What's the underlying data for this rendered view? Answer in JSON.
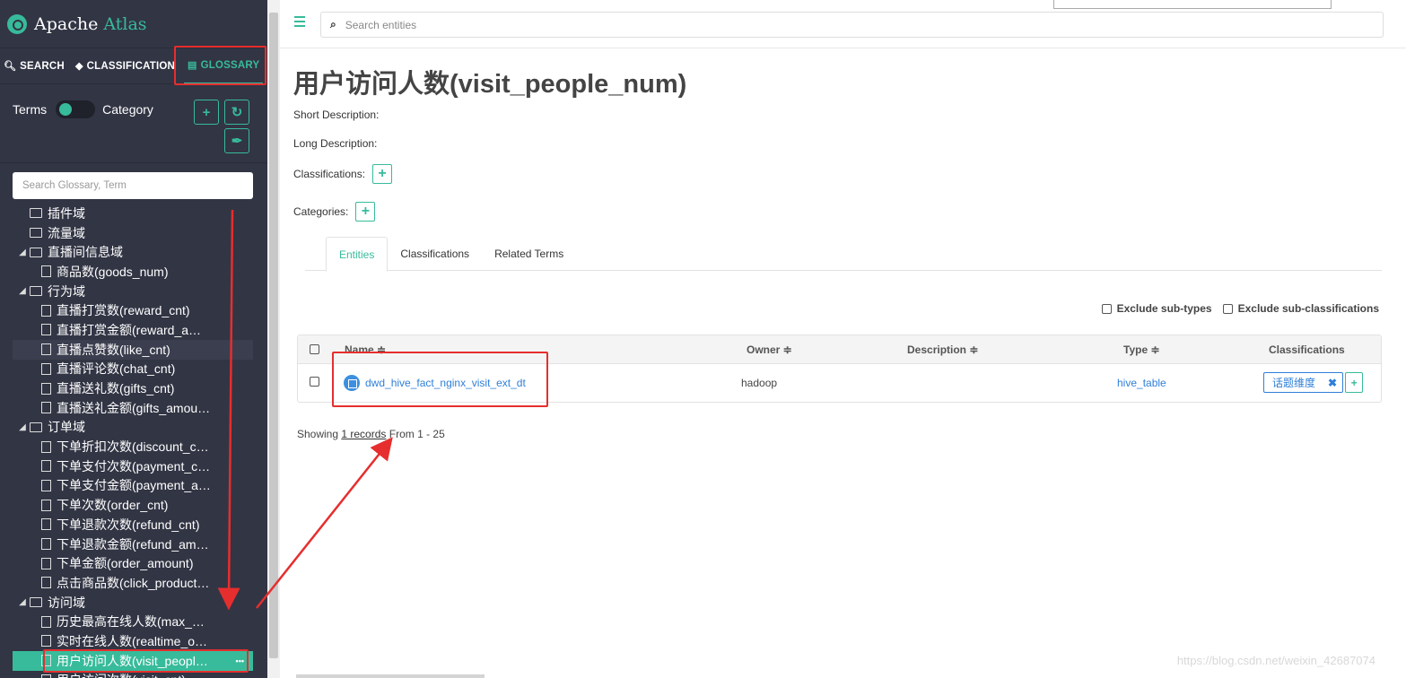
{
  "app": {
    "logo_prefix": "Apache ",
    "logo_accent": "Atlas",
    "accent_color": "#37bb9b",
    "annotation_color": "#e62e2e"
  },
  "sidebar": {
    "nav": {
      "search": "SEARCH",
      "classification": "CLASSIFICATION",
      "glossary": "GLOSSARY"
    },
    "toggle_left": "Terms",
    "toggle_right": "Category",
    "search_placeholder": "Search Glossary, Term",
    "tree": [
      {
        "label": "插件域",
        "type": "folder",
        "level": 0,
        "expanded": false
      },
      {
        "label": "流量域",
        "type": "folder",
        "level": 0,
        "expanded": false
      },
      {
        "label": "直播间信息域",
        "type": "folder",
        "level": 0,
        "expanded": true
      },
      {
        "label": "商品数(goods_num)",
        "type": "term",
        "level": 1
      },
      {
        "label": "行为域",
        "type": "folder",
        "level": 0,
        "expanded": true
      },
      {
        "label": "直播打赏数(reward_cnt)",
        "type": "term",
        "level": 1
      },
      {
        "label": "直播打赏金额(reward_a…",
        "type": "term",
        "level": 1
      },
      {
        "label": "直播点赞数(like_cnt)",
        "type": "term",
        "level": 1,
        "hover": true
      },
      {
        "label": "直播评论数(chat_cnt)",
        "type": "term",
        "level": 1
      },
      {
        "label": "直播送礼数(gifts_cnt)",
        "type": "term",
        "level": 1
      },
      {
        "label": "直播送礼金额(gifts_amou…",
        "type": "term",
        "level": 1
      },
      {
        "label": "订单域",
        "type": "folder",
        "level": 0,
        "expanded": true
      },
      {
        "label": "下单折扣次数(discount_c…",
        "type": "term",
        "level": 1
      },
      {
        "label": "下单支付次数(payment_c…",
        "type": "term",
        "level": 1
      },
      {
        "label": "下单支付金额(payment_a…",
        "type": "term",
        "level": 1
      },
      {
        "label": "下单次数(order_cnt)",
        "type": "term",
        "level": 1
      },
      {
        "label": "下单退款次数(refund_cnt)",
        "type": "term",
        "level": 1
      },
      {
        "label": "下单退款金额(refund_am…",
        "type": "term",
        "level": 1
      },
      {
        "label": "下单金额(order_amount)",
        "type": "term",
        "level": 1
      },
      {
        "label": "点击商品数(click_product…",
        "type": "term",
        "level": 1
      },
      {
        "label": "访问域",
        "type": "folder",
        "level": 0,
        "expanded": true
      },
      {
        "label": "历史最高在线人数(max_…",
        "type": "term",
        "level": 1
      },
      {
        "label": "实时在线人数(realtime_o…",
        "type": "term",
        "level": 1
      },
      {
        "label": "用户访问人数(visit_peopl…",
        "type": "term",
        "level": 1,
        "selected": true
      },
      {
        "label": "用户访问次数(visit_cnt)",
        "type": "term",
        "level": 1
      }
    ]
  },
  "main": {
    "search_placeholder": "Search entities",
    "title": "用户访问人数(visit_people_num)",
    "short_description_label": "Short Description:",
    "long_description_label": "Long Description:",
    "classifications_label": "Classifications:",
    "categories_label": "Categories:",
    "tabs": [
      "Entities",
      "Classifications",
      "Related Terms"
    ],
    "exclude_subtypes": "Exclude sub-types",
    "exclude_subclassifications": "Exclude sub-classifications",
    "table": {
      "columns": [
        "Name ≑",
        "Owner ≑",
        "Description ≑",
        "Type ≑",
        "Classifications"
      ],
      "rows": [
        {
          "name": "dwd_hive_fact_nginx_visit_ext_dt",
          "owner": "hadoop",
          "description": "",
          "type": "hive_table",
          "classification": "话题维度"
        }
      ]
    },
    "showing_prefix": "Showing ",
    "showing_link": "1 records",
    "showing_suffix": " From 1 - 25"
  },
  "watermark": "https://blog.csdn.net/weixin_42687074"
}
